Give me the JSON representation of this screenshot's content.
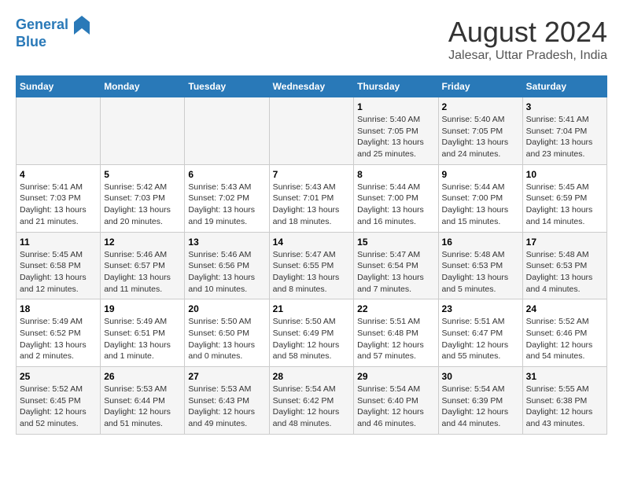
{
  "header": {
    "logo_line1": "General",
    "logo_line2": "Blue",
    "title": "August 2024",
    "subtitle": "Jalesar, Uttar Pradesh, India"
  },
  "calendar": {
    "days_of_week": [
      "Sunday",
      "Monday",
      "Tuesday",
      "Wednesday",
      "Thursday",
      "Friday",
      "Saturday"
    ],
    "weeks": [
      [
        {
          "day": "",
          "info": ""
        },
        {
          "day": "",
          "info": ""
        },
        {
          "day": "",
          "info": ""
        },
        {
          "day": "",
          "info": ""
        },
        {
          "day": "1",
          "info": "Sunrise: 5:40 AM\nSunset: 7:05 PM\nDaylight: 13 hours and 25 minutes."
        },
        {
          "day": "2",
          "info": "Sunrise: 5:40 AM\nSunset: 7:05 PM\nDaylight: 13 hours and 24 minutes."
        },
        {
          "day": "3",
          "info": "Sunrise: 5:41 AM\nSunset: 7:04 PM\nDaylight: 13 hours and 23 minutes."
        }
      ],
      [
        {
          "day": "4",
          "info": "Sunrise: 5:41 AM\nSunset: 7:03 PM\nDaylight: 13 hours and 21 minutes."
        },
        {
          "day": "5",
          "info": "Sunrise: 5:42 AM\nSunset: 7:03 PM\nDaylight: 13 hours and 20 minutes."
        },
        {
          "day": "6",
          "info": "Sunrise: 5:43 AM\nSunset: 7:02 PM\nDaylight: 13 hours and 19 minutes."
        },
        {
          "day": "7",
          "info": "Sunrise: 5:43 AM\nSunset: 7:01 PM\nDaylight: 13 hours and 18 minutes."
        },
        {
          "day": "8",
          "info": "Sunrise: 5:44 AM\nSunset: 7:00 PM\nDaylight: 13 hours and 16 minutes."
        },
        {
          "day": "9",
          "info": "Sunrise: 5:44 AM\nSunset: 7:00 PM\nDaylight: 13 hours and 15 minutes."
        },
        {
          "day": "10",
          "info": "Sunrise: 5:45 AM\nSunset: 6:59 PM\nDaylight: 13 hours and 14 minutes."
        }
      ],
      [
        {
          "day": "11",
          "info": "Sunrise: 5:45 AM\nSunset: 6:58 PM\nDaylight: 13 hours and 12 minutes."
        },
        {
          "day": "12",
          "info": "Sunrise: 5:46 AM\nSunset: 6:57 PM\nDaylight: 13 hours and 11 minutes."
        },
        {
          "day": "13",
          "info": "Sunrise: 5:46 AM\nSunset: 6:56 PM\nDaylight: 13 hours and 10 minutes."
        },
        {
          "day": "14",
          "info": "Sunrise: 5:47 AM\nSunset: 6:55 PM\nDaylight: 13 hours and 8 minutes."
        },
        {
          "day": "15",
          "info": "Sunrise: 5:47 AM\nSunset: 6:54 PM\nDaylight: 13 hours and 7 minutes."
        },
        {
          "day": "16",
          "info": "Sunrise: 5:48 AM\nSunset: 6:53 PM\nDaylight: 13 hours and 5 minutes."
        },
        {
          "day": "17",
          "info": "Sunrise: 5:48 AM\nSunset: 6:53 PM\nDaylight: 13 hours and 4 minutes."
        }
      ],
      [
        {
          "day": "18",
          "info": "Sunrise: 5:49 AM\nSunset: 6:52 PM\nDaylight: 13 hours and 2 minutes."
        },
        {
          "day": "19",
          "info": "Sunrise: 5:49 AM\nSunset: 6:51 PM\nDaylight: 13 hours and 1 minute."
        },
        {
          "day": "20",
          "info": "Sunrise: 5:50 AM\nSunset: 6:50 PM\nDaylight: 13 hours and 0 minutes."
        },
        {
          "day": "21",
          "info": "Sunrise: 5:50 AM\nSunset: 6:49 PM\nDaylight: 12 hours and 58 minutes."
        },
        {
          "day": "22",
          "info": "Sunrise: 5:51 AM\nSunset: 6:48 PM\nDaylight: 12 hours and 57 minutes."
        },
        {
          "day": "23",
          "info": "Sunrise: 5:51 AM\nSunset: 6:47 PM\nDaylight: 12 hours and 55 minutes."
        },
        {
          "day": "24",
          "info": "Sunrise: 5:52 AM\nSunset: 6:46 PM\nDaylight: 12 hours and 54 minutes."
        }
      ],
      [
        {
          "day": "25",
          "info": "Sunrise: 5:52 AM\nSunset: 6:45 PM\nDaylight: 12 hours and 52 minutes."
        },
        {
          "day": "26",
          "info": "Sunrise: 5:53 AM\nSunset: 6:44 PM\nDaylight: 12 hours and 51 minutes."
        },
        {
          "day": "27",
          "info": "Sunrise: 5:53 AM\nSunset: 6:43 PM\nDaylight: 12 hours and 49 minutes."
        },
        {
          "day": "28",
          "info": "Sunrise: 5:54 AM\nSunset: 6:42 PM\nDaylight: 12 hours and 48 minutes."
        },
        {
          "day": "29",
          "info": "Sunrise: 5:54 AM\nSunset: 6:40 PM\nDaylight: 12 hours and 46 minutes."
        },
        {
          "day": "30",
          "info": "Sunrise: 5:54 AM\nSunset: 6:39 PM\nDaylight: 12 hours and 44 minutes."
        },
        {
          "day": "31",
          "info": "Sunrise: 5:55 AM\nSunset: 6:38 PM\nDaylight: 12 hours and 43 minutes."
        }
      ]
    ]
  }
}
